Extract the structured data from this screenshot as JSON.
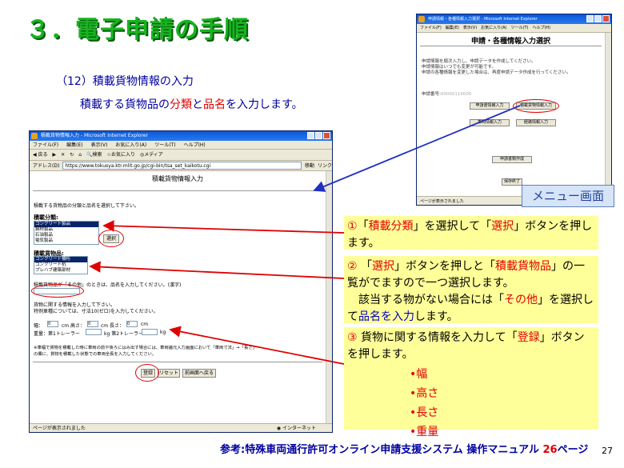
{
  "slide": {
    "title": "３．電子申請の手順",
    "subtitle": "（12）積載貨物情報の入力",
    "lead_pre": "積載する貨物品の",
    "lead_red1": "分類",
    "lead_mid": "と",
    "lead_red2": "品名",
    "lead_post": "を入力します。",
    "reference_pre": "参考:特殊車両通行許可オンライン申請支援システム 操作マニュアル ",
    "reference_num": "26",
    "reference_post": "ページ",
    "page_number": "27",
    "menu_label": "メニュー画面"
  },
  "browser": {
    "window_title": "積載貨物情報入力 - Microsoft Internet Explorer",
    "menus": [
      "ファイル(F)",
      "編集(E)",
      "表示(V)",
      "お気に入り(A)",
      "ツール(T)",
      "ヘルプ(H)"
    ],
    "toolbar": [
      "戻る",
      "検索",
      "お気に入り",
      "メディア"
    ],
    "address_label": "アドレス(D)",
    "address_url": "https://www.tokusya.ktr.mlit.go.jp/cgi-bin/tsa_set_kaikotu.cgi",
    "go_label": "移動",
    "links_label": "リンク",
    "page_title": "積載貨物情報入力",
    "instruction": "積載する貨物品の分類と品名を選択して下さい。",
    "category_label": "積載分類:",
    "category_options": [
      "コンクリート製品",
      "鋼材製品",
      "石油製品",
      "電気製品"
    ],
    "select_button": "選択",
    "item_label": "積載貨物品:",
    "item_options": [
      "コンクリート橋桁",
      "コンクリート杭",
      "プレハブ建築部材"
    ],
    "other_note": "積載貨物品が「その他」のときは、品名を入力してください。(漢字)",
    "cargo_info_note": "貨物に関する情報を入力して下さい。",
    "special_note": "特例車種については、寸法10(ゼロ)を入力してください。",
    "width_label": "幅：",
    "width_value": "0",
    "height_label": "cm 高さ：",
    "height_value": "0",
    "length_label": "cm 長さ：",
    "length_value": "0",
    "cm_label": "cm",
    "weight_label": "重量：第1トレーラー",
    "kg1": "kg 第2トレーラー",
    "kg2": "kg",
    "bottom_note1": "※車幅で貨物を積載した時に車両の前や後ろにはみ出す場合には、車両諸元入力画面において「車両寸法」→「長さ」",
    "bottom_note2": "の欄に、貨物を積載した状態での車両全長を入力してください。",
    "register_button": "登録",
    "reset_button": "リセット",
    "back_button": "前画面へ戻る",
    "status_left": "ページが表示されました",
    "status_right": "インターネット"
  },
  "menu_window": {
    "window_title": "申請情報・各種情報入力選択 - Microsoft Internet Explorer",
    "menus": [
      "ファイル(F)",
      "編集(E)",
      "表示(V)",
      "お気に入り(A)",
      "ツール(T)",
      "ヘルプ(H)"
    ],
    "page_title": "申請・各種情報入力選択",
    "line1": "申請情報を順次入力し、申請データを作成してください。",
    "line2": "申請情報はいつでも変更が可能です。",
    "line3": "申請の各種情報を変更した場合は、再度申請データ作成を行ってください。",
    "app_no_label": "申請番号:",
    "app_no_value": "00000110000",
    "btn_apply_info": "申請書情報入力",
    "btn_cargo_info": "積載貨物情報入力",
    "btn_vehicle_info": "車両情報入力",
    "btn_route_info": "経路情報入力",
    "btn_create_data": "申請書類作成",
    "btn_finish": "保存終了",
    "status_left": "ページが表示されました"
  },
  "callouts": {
    "c1_num": "①",
    "c1_q1": "「",
    "c1_a": "積載分類",
    "c1_q2": "」を選択して「",
    "c1_b": "選択",
    "c1_q3": "」ボタンを押します。",
    "c2_num": "②",
    "c2_q1": "「",
    "c2_a": "選択",
    "c2_q2": "」ボタンを押しと「",
    "c2_b": "積載貨物品",
    "c2_q3": "」の一覧がでますので一つ選択します。",
    "c2_l2_pre": "　該当する物がない場合には「",
    "c2_l2_red": "その他",
    "c2_l2_mid": "」を選択して",
    "c2_l2_blue": "品名を入力",
    "c2_l2_post": "します。",
    "c3_num": "③",
    "c3_pre": " 貨物に関する情報を入力して「",
    "c3_red": "登録",
    "c3_post": "」ボタンを押します。",
    "bullets": [
      "•幅",
      "•高さ",
      "•長さ",
      "•重量"
    ]
  },
  "colors": {
    "title_green": "#16b41e",
    "emphasis_red": "#e00000",
    "body_blue": "#0000a0",
    "callout_bg": "#ffff99"
  }
}
